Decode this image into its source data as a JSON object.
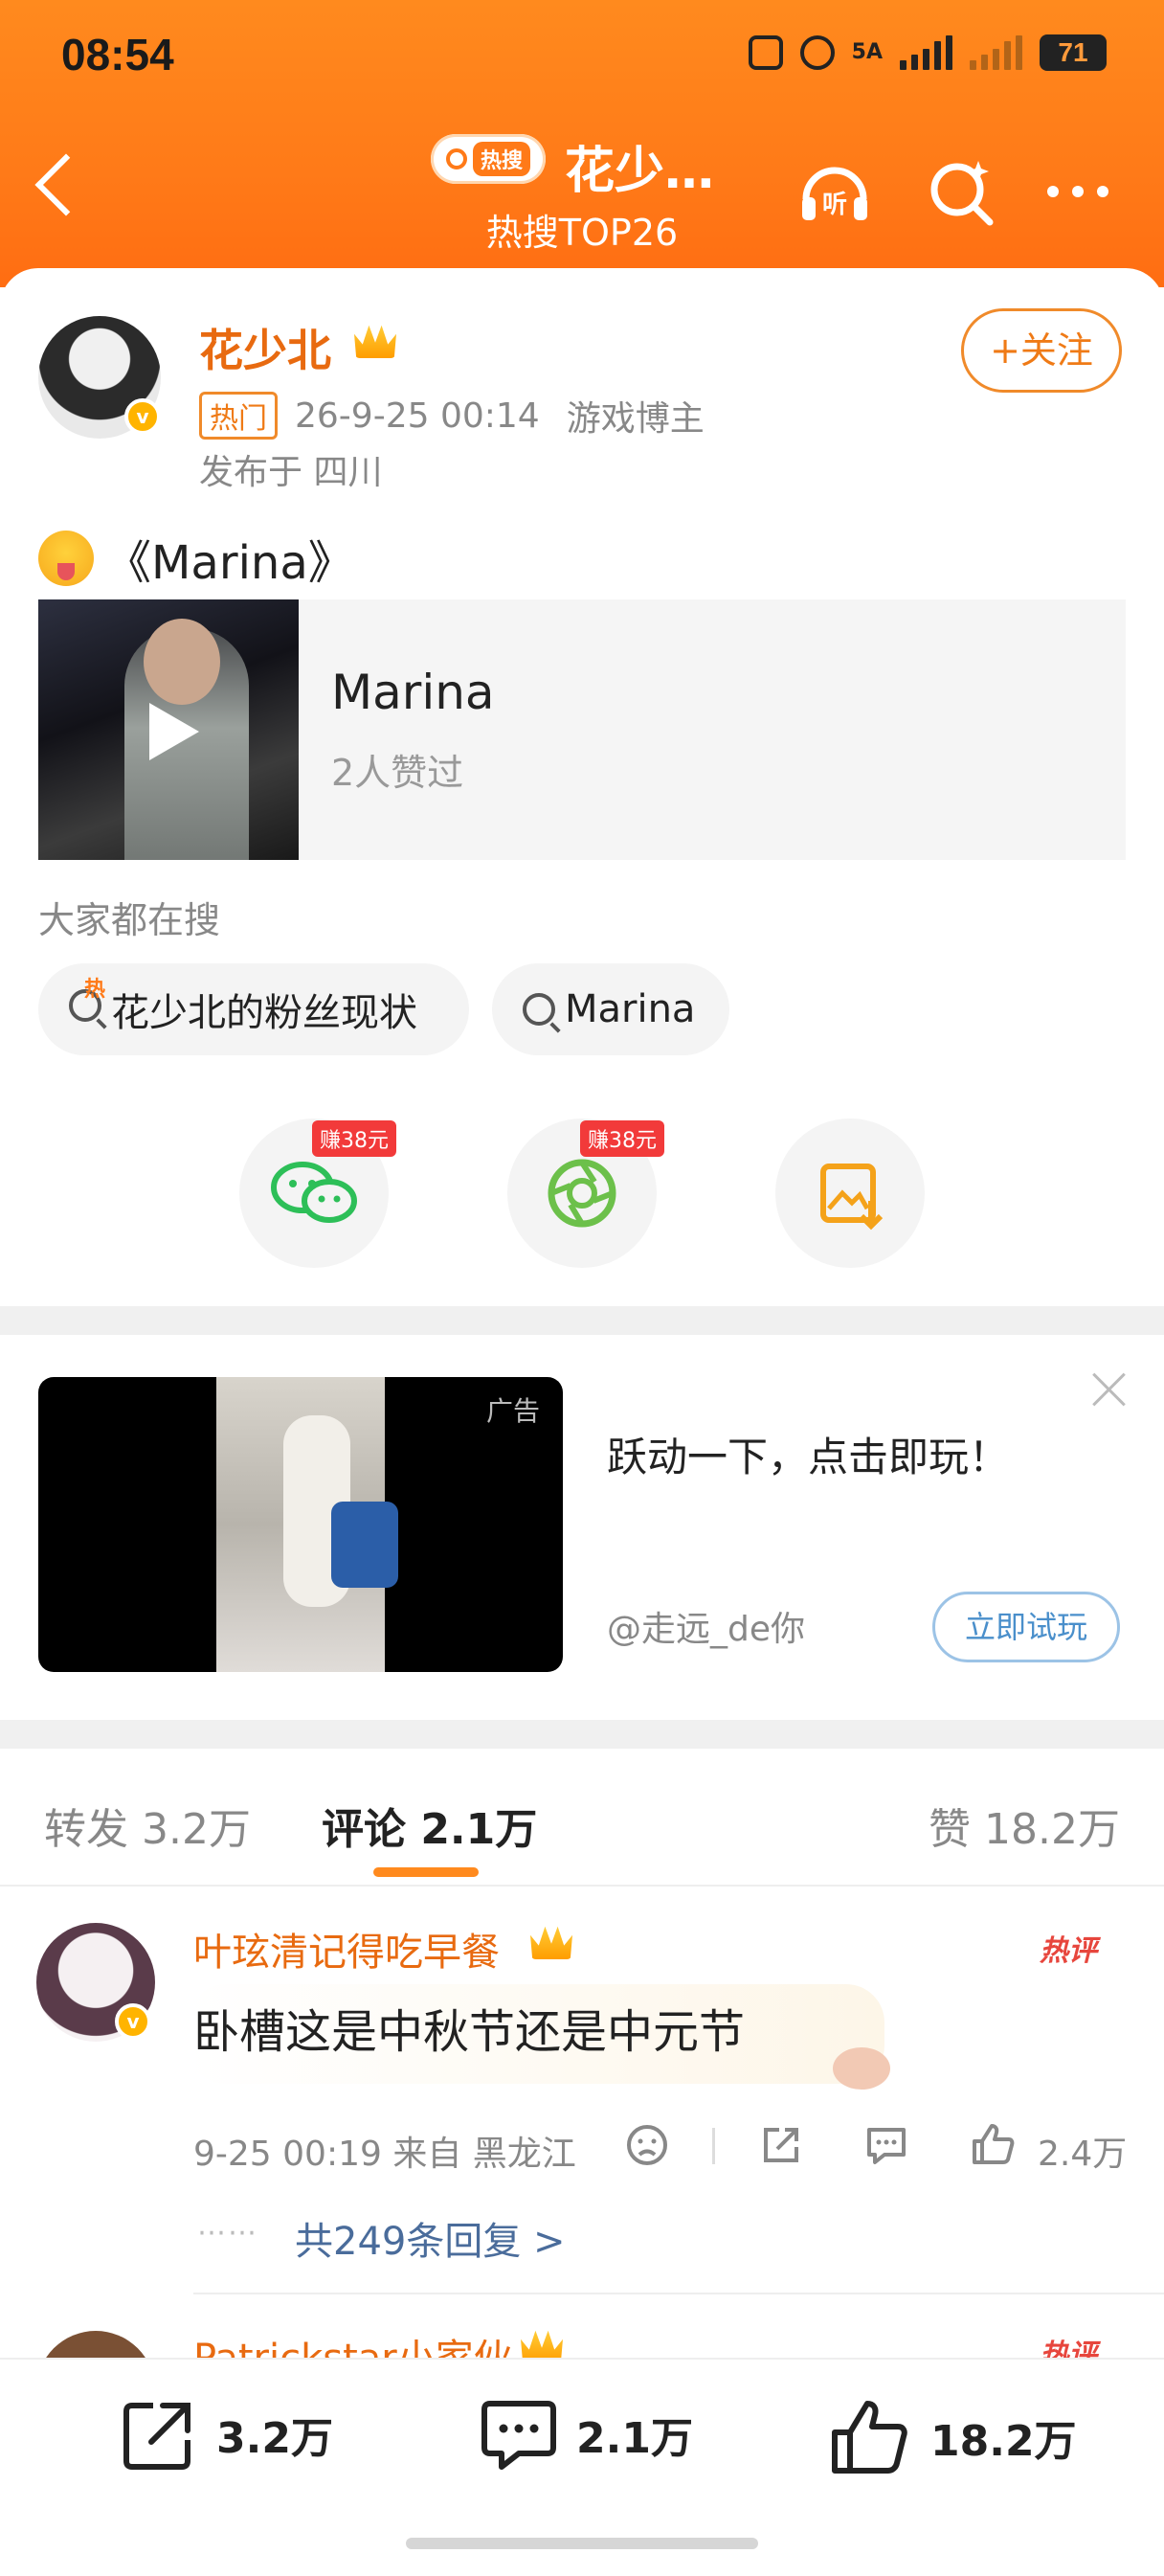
{
  "status_bar": {
    "time": "08:54",
    "network": "5A",
    "battery": "71"
  },
  "header": {
    "hot_badge": "热搜",
    "title": "花少…",
    "subtitle": "热搜TOP26",
    "listen_label": "听"
  },
  "post": {
    "author": "花少北",
    "follow_label": "+关注",
    "tag": "热门",
    "timestamp": "26-9-25 00:14",
    "role": "游戏博主",
    "location": "发布于 四川",
    "text": "《Marina》",
    "music": {
      "title": "Marina",
      "likes": "2人赞过"
    }
  },
  "search_section": {
    "label": "大家都在搜",
    "chips": [
      "花少北的粉丝现状",
      "Marina"
    ],
    "hot_chip_icon": "热"
  },
  "share_buttons": [
    {
      "icon": "wechat-icon",
      "badge": "赚38元"
    },
    {
      "icon": "moments-icon",
      "badge": "赚38元"
    },
    {
      "icon": "save-image-icon",
      "badge": ""
    }
  ],
  "ad": {
    "tag": "广告",
    "title": "跃动一下，点击即玩！",
    "user": "@走远_de你",
    "button": "立即试玩"
  },
  "tabs": {
    "repost": "转发 3.2万",
    "comments": "评论 2.1万",
    "likes": "赞 18.2万"
  },
  "comments": [
    {
      "user": "叶玹清记得吃早餐",
      "text": "卧槽这是中秋节还是中元节",
      "badge": "热评",
      "meta": "9-25 00:19  来自 黑龙江",
      "like_count": "2.4万",
      "replies": "共249条回复 >"
    },
    {
      "user": "Patrickstar小家伙",
      "badge": "热评"
    }
  ],
  "bottom_bar": {
    "share": "3.2万",
    "comment": "2.1万",
    "like": "18.2万"
  },
  "colors": {
    "accent": "#ff7a18",
    "link": "#4a6c9b",
    "hot": "#e7463d"
  }
}
